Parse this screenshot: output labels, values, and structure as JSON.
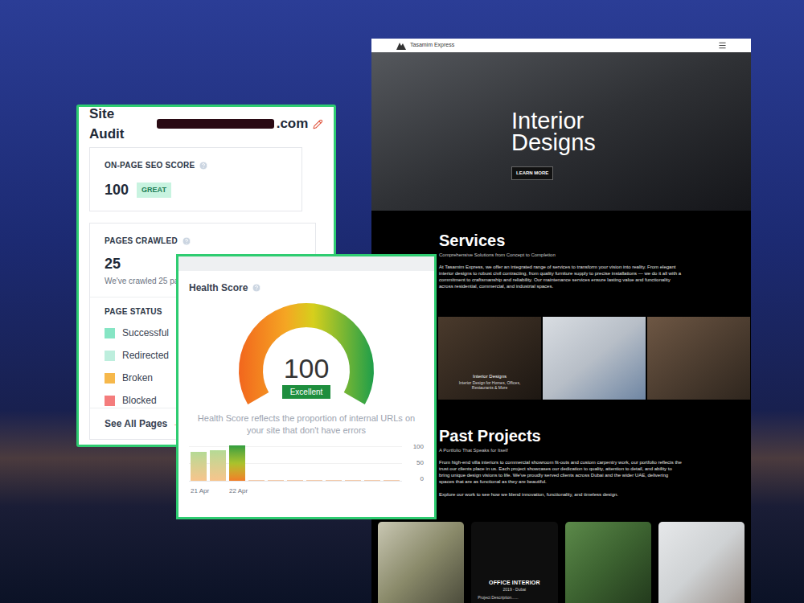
{
  "site_audit": {
    "title": "Site Audit",
    "domain": ".com",
    "seo_score": {
      "label": "ON-PAGE SEO SCORE",
      "value": "100",
      "badge": "GREAT"
    },
    "pages_crawled": {
      "label": "PAGES CRAWLED",
      "value": "25",
      "note": "We've crawled 25 pag"
    },
    "page_status": {
      "label": "PAGE STATUS",
      "items": [
        {
          "label": "Successful",
          "color": "#86e5c4"
        },
        {
          "label": "Redirected",
          "color": "#bdeedd"
        },
        {
          "label": "Broken",
          "color": "#f6b84b"
        },
        {
          "label": "Blocked",
          "color": "#f47c7c"
        }
      ]
    },
    "link": {
      "label": "See All Pages",
      "arrow": "→"
    }
  },
  "health": {
    "title": "Health Score",
    "score": "100",
    "level": 1,
    "badge": "Excellent",
    "description": "Health Score reflects the proportion of internal URLs on your site that don't have errors",
    "chart": {
      "ticks": [
        "100",
        "50",
        "0"
      ],
      "bars": [
        {
          "value": 82,
          "label": "21 Apr",
          "selected": false
        },
        {
          "value": 86,
          "label": "",
          "selected": false
        },
        {
          "value": 100,
          "label": "22 Apr",
          "selected": true
        },
        {
          "value": 0,
          "label": "",
          "selected": false
        },
        {
          "value": 0,
          "label": "",
          "selected": false
        },
        {
          "value": 0,
          "label": "",
          "selected": false
        },
        {
          "value": 0,
          "label": "",
          "selected": false
        },
        {
          "value": 0,
          "label": "",
          "selected": false
        },
        {
          "value": 0,
          "label": "",
          "selected": false
        },
        {
          "value": 0,
          "label": "",
          "selected": false
        },
        {
          "value": 0,
          "label": "",
          "selected": false
        }
      ]
    }
  },
  "website": {
    "brand": "Tasamim Express",
    "hero": {
      "title": "Interior Designs",
      "button": "LEARN MORE"
    },
    "services": {
      "title": "Services",
      "subtitle": "Comprehensive Solutions from Concept to Completion",
      "text": "At Tasamim Express, we offer an integrated range of services to transform your vision into reality. From elegant interior designs to robust civil contracting, from quality furniture supply to precise installations — we do it all with a commitment to craftsmanship and reliability. Our maintenance services ensure lasting value and functionality across residential, commercial, and industrial spaces.",
      "cards": [
        {
          "kind": "captioned",
          "title": "Interior Designs",
          "subtitle": "Interior Design for Homes, Offices, Restaurants & More"
        },
        {
          "kind": "photo"
        },
        {
          "kind": "photo"
        }
      ]
    },
    "projects": {
      "title": "Past Projects",
      "subtitle": "A Portfolio That Speaks for Itself",
      "text": "From high-end villa interiors to commercial showroom fit-outs and custom carpentry work, our portfolio reflects the trust our clients place in us. Each project showcases our dedication to quality, attention to detail, and ability to bring unique design visions to life. We've proudly served clients across Dubai and the wider UAE, delivering spaces that are as functional as they are beautiful.",
      "explore": "Explore our work to see how we blend innovation, functionality, and timeless design.",
      "cards": [
        {
          "kind": "photo"
        },
        {
          "kind": "captioned",
          "title": "OFFICE INTERIOR",
          "meta": "2019 - Dubai",
          "description": "Project Description......"
        },
        {
          "kind": "photo"
        },
        {
          "kind": "photo"
        }
      ]
    }
  }
}
